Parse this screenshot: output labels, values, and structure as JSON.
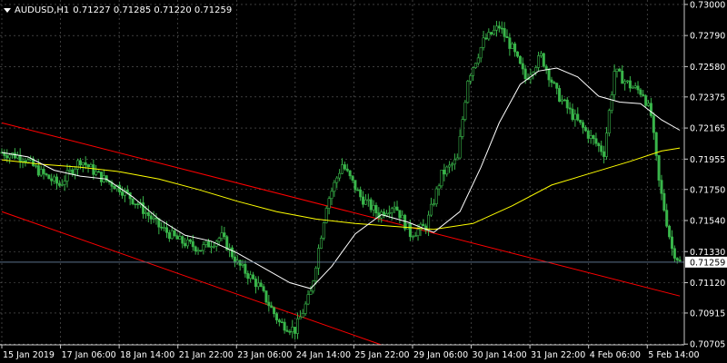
{
  "window": {
    "symbol_label": "AUDUSD,H1",
    "ohlc_label": "0.71227 0.71285 0.71220 0.71259"
  },
  "colors": {
    "background": "#000000",
    "grid": "#b4b4b4",
    "axis": "#c8c8c8",
    "text": "#ffffff",
    "candles": "#39b54a",
    "ma_fast": "#ffffff",
    "ma_slow": "#ffff00",
    "channel": "#ff0000",
    "price_line": "#5a6f8a",
    "price_label_bg": "#ffffff",
    "price_label_text": "#000000"
  },
  "chart_data": {
    "type": "candlestick",
    "symbol": "AUDUSD",
    "timeframe": "H1",
    "last_price": "0.71259",
    "ylim": [
      0.707,
      0.7303
    ],
    "y_ticks": [
      "0.73000",
      "0.72790",
      "0.72580",
      "0.72375",
      "0.72165",
      "0.71955",
      "0.71750",
      "0.71540",
      "0.71330",
      "0.71120",
      "0.70915",
      "0.70705"
    ],
    "x_ticks": [
      "15 Jan 2019",
      "17 Jan 06:00",
      "18 Jan 14:00",
      "21 Jan 22:00",
      "23 Jan 06:00",
      "24 Jan 14:00",
      "25 Jan 22:00",
      "29 Jan 06:00",
      "30 Jan 14:00",
      "31 Jan 22:00",
      "4 Feb 06:00",
      "5 Feb 14:00"
    ],
    "price_keypoints": [
      [
        0,
        0.72
      ],
      [
        8,
        0.7197
      ],
      [
        15,
        0.7186
      ],
      [
        22,
        0.7178
      ],
      [
        30,
        0.7195
      ],
      [
        38,
        0.7183
      ],
      [
        45,
        0.7176
      ],
      [
        52,
        0.7165
      ],
      [
        60,
        0.715
      ],
      [
        68,
        0.714
      ],
      [
        76,
        0.7135
      ],
      [
        84,
        0.7143
      ],
      [
        90,
        0.7125
      ],
      [
        98,
        0.711
      ],
      [
        106,
        0.7085
      ],
      [
        112,
        0.708
      ],
      [
        118,
        0.7105
      ],
      [
        124,
        0.7165
      ],
      [
        130,
        0.7192
      ],
      [
        137,
        0.717
      ],
      [
        144,
        0.7158
      ],
      [
        150,
        0.7165
      ],
      [
        156,
        0.7145
      ],
      [
        162,
        0.715
      ],
      [
        168,
        0.7185
      ],
      [
        174,
        0.7195
      ],
      [
        178,
        0.725
      ],
      [
        184,
        0.7275
      ],
      [
        190,
        0.7285
      ],
      [
        195,
        0.727
      ],
      [
        200,
        0.725
      ],
      [
        206,
        0.7265
      ],
      [
        212,
        0.724
      ],
      [
        218,
        0.7225
      ],
      [
        224,
        0.7212
      ],
      [
        230,
        0.72
      ],
      [
        234,
        0.7255
      ],
      [
        240,
        0.7245
      ],
      [
        245,
        0.724
      ],
      [
        248,
        0.7225
      ],
      [
        251,
        0.718
      ],
      [
        256,
        0.7135
      ],
      [
        259,
        0.7126
      ]
    ],
    "ma_fast": [
      [
        0,
        0.72
      ],
      [
        10,
        0.7197
      ],
      [
        20,
        0.7188
      ],
      [
        30,
        0.7184
      ],
      [
        40,
        0.7182
      ],
      [
        50,
        0.717
      ],
      [
        60,
        0.7155
      ],
      [
        70,
        0.7144
      ],
      [
        80,
        0.714
      ],
      [
        90,
        0.7132
      ],
      [
        100,
        0.7122
      ],
      [
        110,
        0.7112
      ],
      [
        118,
        0.7108
      ],
      [
        126,
        0.7123
      ],
      [
        135,
        0.7145
      ],
      [
        145,
        0.7158
      ],
      [
        155,
        0.7153
      ],
      [
        165,
        0.7146
      ],
      [
        175,
        0.716
      ],
      [
        183,
        0.719
      ],
      [
        190,
        0.722
      ],
      [
        198,
        0.7246
      ],
      [
        205,
        0.7255
      ],
      [
        212,
        0.7257
      ],
      [
        220,
        0.7251
      ],
      [
        228,
        0.7238
      ],
      [
        236,
        0.7234
      ],
      [
        244,
        0.7233
      ],
      [
        252,
        0.7222
      ],
      [
        259,
        0.7215
      ]
    ],
    "ma_slow": [
      [
        0,
        0.7195
      ],
      [
        15,
        0.7192
      ],
      [
        30,
        0.719
      ],
      [
        45,
        0.7187
      ],
      [
        60,
        0.7182
      ],
      [
        75,
        0.7175
      ],
      [
        90,
        0.7167
      ],
      [
        105,
        0.716
      ],
      [
        120,
        0.7155
      ],
      [
        135,
        0.7152
      ],
      [
        150,
        0.715
      ],
      [
        165,
        0.7148
      ],
      [
        180,
        0.7152
      ],
      [
        195,
        0.7164
      ],
      [
        210,
        0.7178
      ],
      [
        225,
        0.7186
      ],
      [
        240,
        0.7194
      ],
      [
        252,
        0.7201
      ],
      [
        259,
        0.7203
      ]
    ],
    "channel_upper": [
      [
        0,
        0.722
      ],
      [
        259,
        0.7103
      ]
    ],
    "channel_lower": [
      [
        0,
        0.716
      ],
      [
        145,
        0.707
      ]
    ]
  }
}
